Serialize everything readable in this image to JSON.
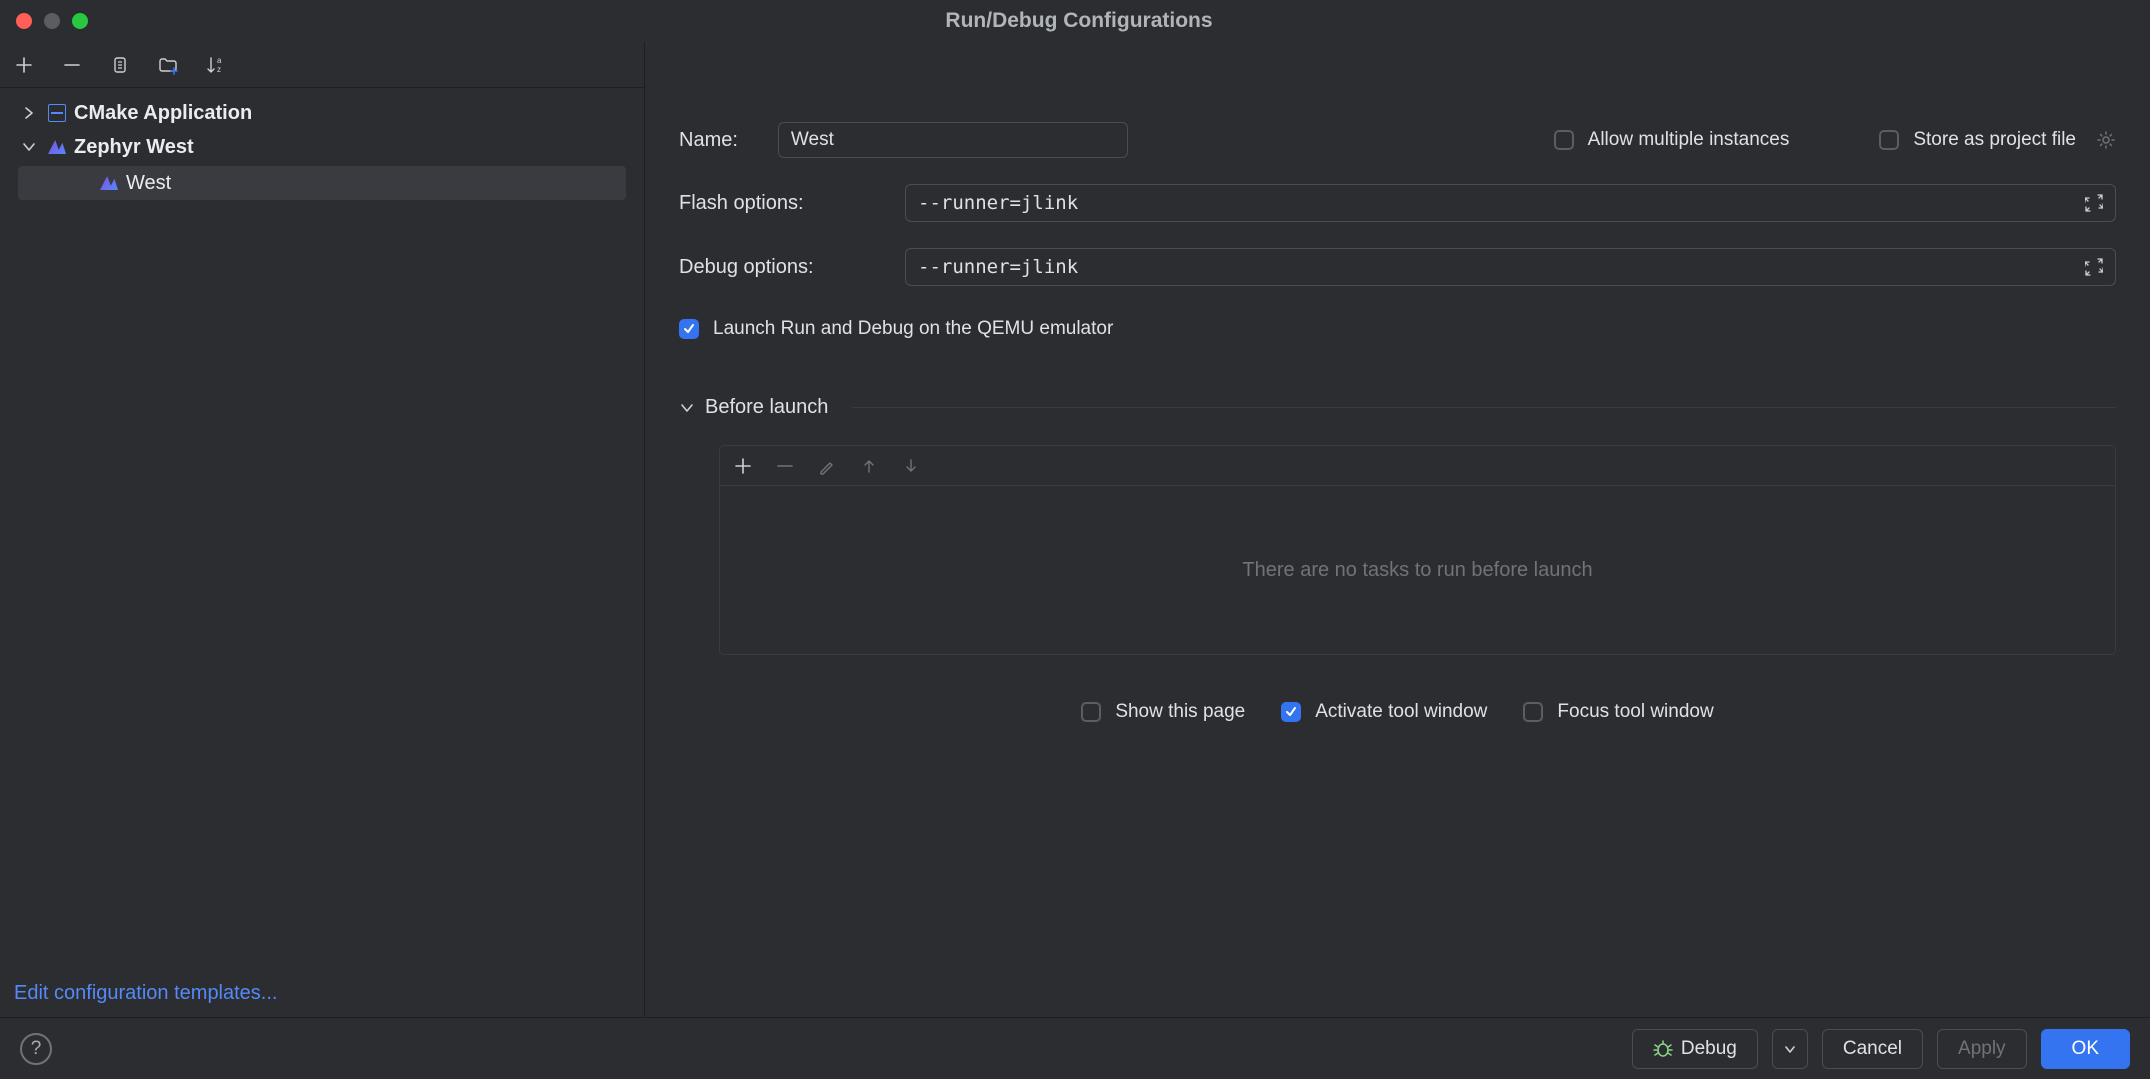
{
  "title": "Run/Debug Configurations",
  "sidebar": {
    "tree": [
      {
        "label": "CMake Application",
        "expanded": false
      },
      {
        "label": "Zephyr West",
        "expanded": true,
        "children": [
          {
            "label": "West",
            "selected": true
          }
        ]
      }
    ],
    "edit_templates": "Edit configuration templates..."
  },
  "form": {
    "name_label": "Name:",
    "name_value": "West",
    "allow_multi_label": "Allow multiple instances",
    "allow_multi_checked": false,
    "store_project_label": "Store as project file",
    "store_project_checked": false,
    "flash_label": "Flash options:",
    "flash_value": "--runner=jlink",
    "debug_label": "Debug options:",
    "debug_value": "--runner=jlink",
    "qemu_label": "Launch Run and Debug on the QEMU emulator",
    "qemu_checked": true
  },
  "before_launch": {
    "title": "Before launch",
    "empty_text": "There are no tasks to run before launch",
    "show_page_label": "Show this page",
    "show_page_checked": false,
    "activate_label": "Activate tool window",
    "activate_checked": true,
    "focus_label": "Focus tool window",
    "focus_checked": false
  },
  "buttons": {
    "debug": "Debug",
    "cancel": "Cancel",
    "apply": "Apply",
    "ok": "OK"
  }
}
